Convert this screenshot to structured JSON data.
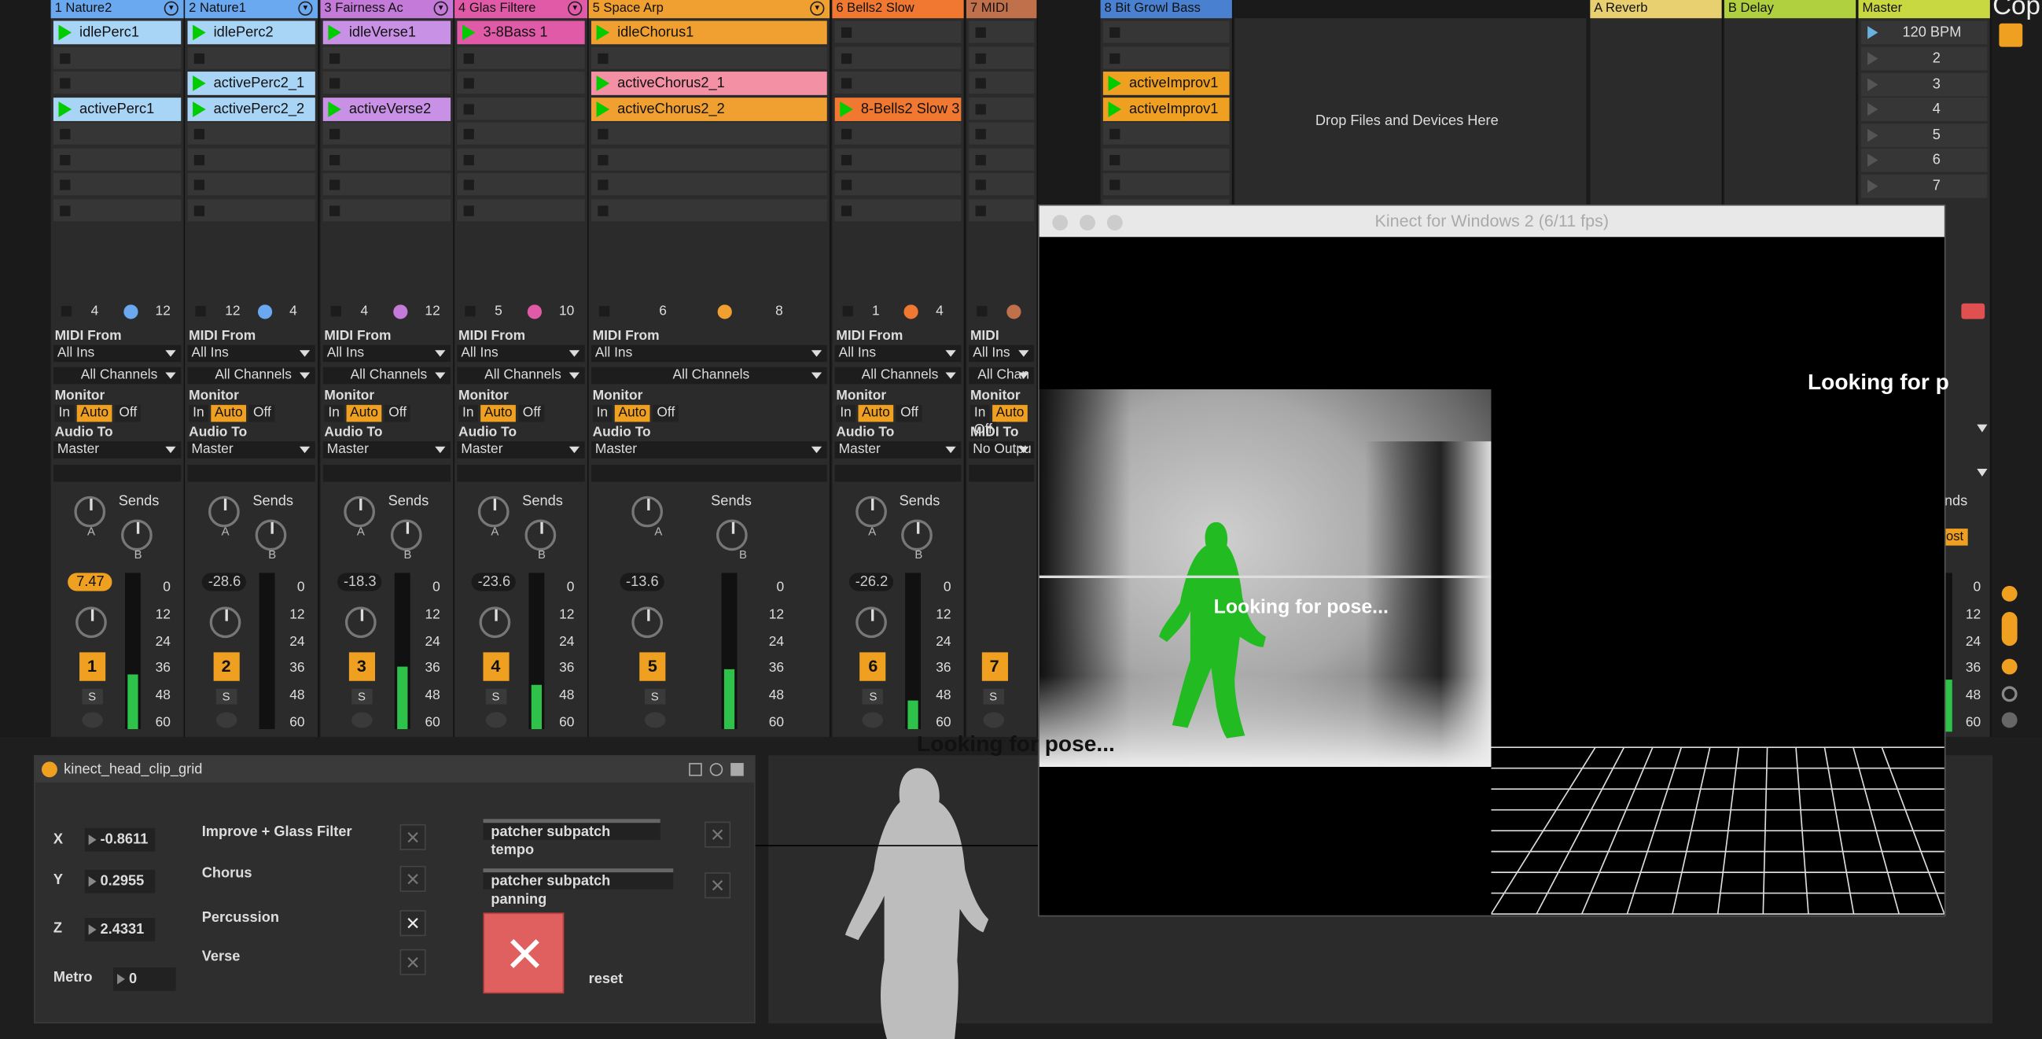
{
  "tracks": [
    {
      "name": "1 Nature2",
      "color": "#6aa8f0",
      "clips": [
        {
          "slot": 0,
          "label": "idlePerc1",
          "color": "#a8d4f6"
        },
        {
          "slot": 3,
          "label": "activePerc1",
          "color": "#a8d4f6"
        }
      ],
      "in": "4",
      "out": "12",
      "midi_from": "All Ins",
      "channel": "All Channels",
      "audio_to": "Master",
      "volume": "7.47",
      "number": "1",
      "meter": 0.35
    },
    {
      "name": "2 Nature1",
      "color": "#6aa8f0",
      "clips": [
        {
          "slot": 0,
          "label": "idlePerc2",
          "color": "#a8d4f6"
        },
        {
          "slot": 2,
          "label": "activePerc2_1",
          "color": "#a8d4f6"
        },
        {
          "slot": 3,
          "label": "activePerc2_2",
          "color": "#a8d4f6"
        }
      ],
      "in": "12",
      "out": "4",
      "midi_from": "All Ins",
      "channel": "All Channels",
      "audio_to": "Master",
      "volume": "-28.6",
      "number": "2",
      "meter": 0.0
    },
    {
      "name": "3 Fairness Ac",
      "color": "#c37ad8",
      "clips": [
        {
          "slot": 0,
          "label": "idleVerse1",
          "color": "#c891e6"
        },
        {
          "slot": 3,
          "label": "activeVerse2",
          "color": "#c891e6"
        }
      ],
      "in": "4",
      "out": "12",
      "midi_from": "All Ins",
      "channel": "All Channels",
      "audio_to": "Master",
      "volume": "-18.3",
      "number": "3",
      "meter": 0.4
    },
    {
      "name": "4 Glas Filtere",
      "color": "#e05aa8",
      "clips": [
        {
          "slot": 0,
          "label": "3-8Bass 1",
          "color": "#e05aa8"
        }
      ],
      "in": "5",
      "out": "10",
      "midi_from": "All Ins",
      "channel": "All Channels",
      "audio_to": "Master",
      "volume": "-23.6",
      "number": "4",
      "meter": 0.28
    },
    {
      "name": "5 Space Arp",
      "color": "#f0a030",
      "clips": [
        {
          "slot": 0,
          "label": "idleChorus1",
          "color": "#f0a030"
        },
        {
          "slot": 2,
          "label": "activeChorus2_1",
          "color": "#f490a4"
        },
        {
          "slot": 3,
          "label": "activeChorus2_2",
          "color": "#f0a030"
        }
      ],
      "in": "6",
      "out": "8",
      "midi_from": "All Ins",
      "channel": "All Channels",
      "audio_to": "Master",
      "volume": "-13.6",
      "number": "5",
      "meter": 0.38
    },
    {
      "name": "6 Bells2 Slow",
      "color": "#f07830",
      "clips": [
        {
          "slot": 3,
          "label": "8-Bells2 Slow 3",
          "color": "#f07830"
        }
      ],
      "in": "1",
      "out": "4",
      "midi_from": "All Ins",
      "channel": "All Channels",
      "audio_to": "Master",
      "volume": "-26.2",
      "number": "6",
      "meter": 0.18
    },
    {
      "name": "7 MIDI",
      "color": "#c0704a",
      "clips": [],
      "in": "",
      "out": "",
      "midi_from": "All Ins",
      "channel": "All Chan",
      "audio_to": "No Outpu",
      "volume": "",
      "number": "7",
      "meter": 0.0
    },
    {
      "name": "8 Bit Growl Bass",
      "color": "#4a80d0",
      "clips": [
        {
          "slot": 2,
          "label": "activeImprov1",
          "color": "#f0a020"
        },
        {
          "slot": 3,
          "label": "activeImprov1",
          "color": "#f0a020"
        }
      ]
    }
  ],
  "returns": [
    {
      "name": "A Reverb",
      "color": "#e8d070"
    },
    {
      "name": "B Delay",
      "color": "#b0d040"
    }
  ],
  "master": {
    "name": "Master",
    "color": "#c8d840",
    "tempo": "120 BPM",
    "scenes": [
      "2",
      "3",
      "4",
      "5",
      "6",
      "7"
    ]
  },
  "labels": {
    "midi_from": "MIDI From",
    "monitor": "Monitor",
    "audio_to": "Audio To",
    "midi_to": "MIDI To",
    "mon_in": "In",
    "mon_auto": "Auto",
    "mon_off": "Off",
    "sends": "Sends",
    "send_a": "A",
    "send_b": "B",
    "solo": "S",
    "drop_zone": "Drop Files and Devices Here",
    "scale": [
      "0",
      "12",
      "24",
      "36",
      "48",
      "60"
    ],
    "cut_off_right": "Cop",
    "master_sends": "nds",
    "master_post": "ost"
  },
  "kinect": {
    "title": "Kinect for Windows 2 (6/11 fps)",
    "status": "Looking for pose...",
    "status_right": "Looking for p",
    "status_bottom": "Looking for pose..."
  },
  "device": {
    "title": "kinect_head_clip_grid",
    "x_label": "X",
    "x": "-0.8611",
    "y_label": "Y",
    "y": "0.2955",
    "z_label": "Z",
    "z": "2.4331",
    "metro_label": "Metro",
    "metro": "0",
    "toggles": [
      {
        "label": "Improve + Glass Filter",
        "checked": false
      },
      {
        "label": "Chorus",
        "checked": false
      },
      {
        "label": "Percussion",
        "checked": true
      },
      {
        "label": "Verse",
        "checked": false
      }
    ],
    "patcher1": "patcher subpatch tempo",
    "patcher2": "patcher subpatch panning",
    "reset": "reset"
  }
}
